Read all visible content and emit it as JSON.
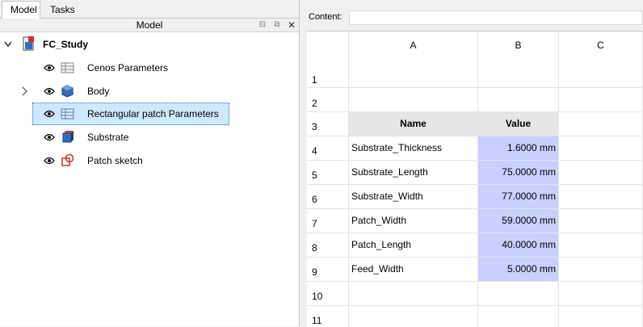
{
  "tabs": {
    "model": "Model",
    "tasks": "Tasks"
  },
  "panel": {
    "title": "Model"
  },
  "tree": {
    "root": "FC_Study",
    "items": [
      {
        "label": "Cenos Parameters"
      },
      {
        "label": "Body"
      },
      {
        "label": "Rectangular patch Parameters"
      },
      {
        "label": "Substrate"
      },
      {
        "label": "Patch sketch"
      }
    ]
  },
  "content": {
    "label": "Content:",
    "value": ""
  },
  "sheet": {
    "columns": [
      "A",
      "B",
      "C"
    ],
    "rows": [
      "1",
      "2",
      "3",
      "4",
      "5",
      "6",
      "7",
      "8",
      "9",
      "10",
      "11"
    ],
    "header": {
      "name": "Name",
      "value": "Value"
    },
    "params": [
      {
        "name": "Substrate_Thickness",
        "value": "1.6000 mm"
      },
      {
        "name": "Substrate_Length",
        "value": "75.0000 mm"
      },
      {
        "name": "Substrate_Width",
        "value": "77.0000 mm"
      },
      {
        "name": "Patch_Width",
        "value": "59.0000 mm"
      },
      {
        "name": "Patch_Length",
        "value": "40.0000 mm"
      },
      {
        "name": "Feed_Width",
        "value": "5.0000 mm"
      }
    ]
  },
  "colors": {
    "selection": "#cde8ff",
    "value_cell": "#c8d0ff",
    "header_cell": "#e6e6e6"
  }
}
